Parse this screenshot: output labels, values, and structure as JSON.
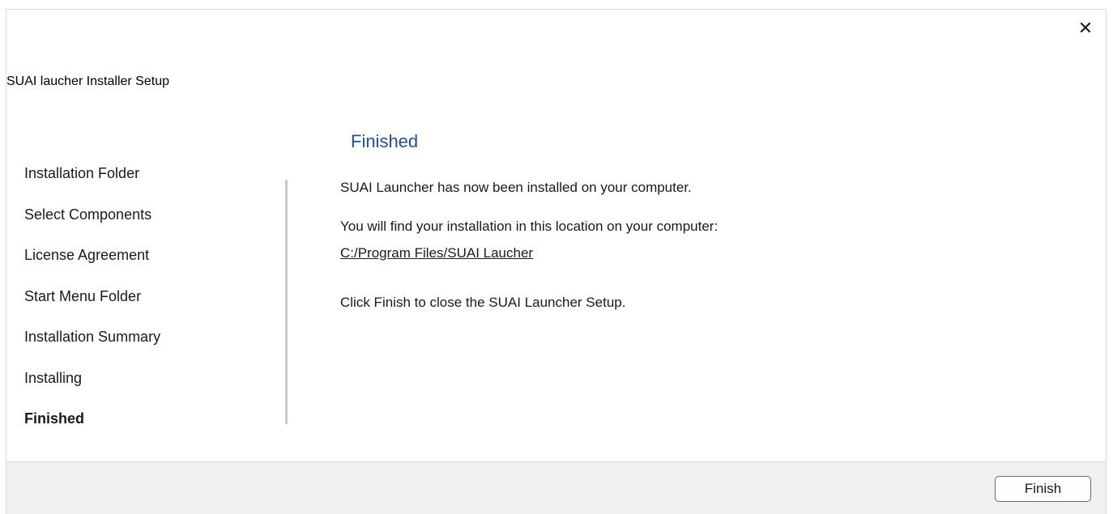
{
  "window": {
    "title": "SUAI laucher Installer Setup",
    "close_icon": "close-icon",
    "close_glyph": "✕"
  },
  "sidebar": {
    "steps": [
      {
        "label": "Installation Folder",
        "active": false
      },
      {
        "label": "Select Components",
        "active": false
      },
      {
        "label": "License Agreement",
        "active": false
      },
      {
        "label": "Start Menu Folder",
        "active": false
      },
      {
        "label": "Installation Summary",
        "active": false
      },
      {
        "label": "Installing",
        "active": false
      },
      {
        "label": "Finished",
        "active": true
      }
    ]
  },
  "main": {
    "title": "Finished",
    "installed_message": "SUAI Launcher has now been installed on your computer.",
    "location_message": "You will find your installation in this location on your computer:",
    "install_path": "C:/Program Files/SUAI Laucher",
    "close_message": "Click Finish to close the SUAI Launcher Setup."
  },
  "footer": {
    "finish_label": "Finish"
  },
  "colors": {
    "title_accent": "#1f4e9e",
    "footer_bg": "#f0f0f0"
  }
}
